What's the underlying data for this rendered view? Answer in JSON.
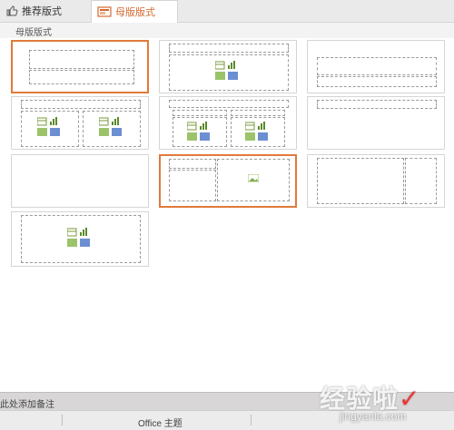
{
  "tabs": [
    {
      "label": "推荐版式",
      "icon": "thumbs-up-icon"
    },
    {
      "label": "母版版式",
      "icon": "slide-layout-icon",
      "active": true
    }
  ],
  "section_title": "母版版式",
  "notes_placeholder": "此处添加备注",
  "status_theme": "Office 主题",
  "watermark": {
    "text": "经验啦",
    "check": "✓",
    "url": "jingyanla.com"
  },
  "accent_color": "#e07a3a"
}
